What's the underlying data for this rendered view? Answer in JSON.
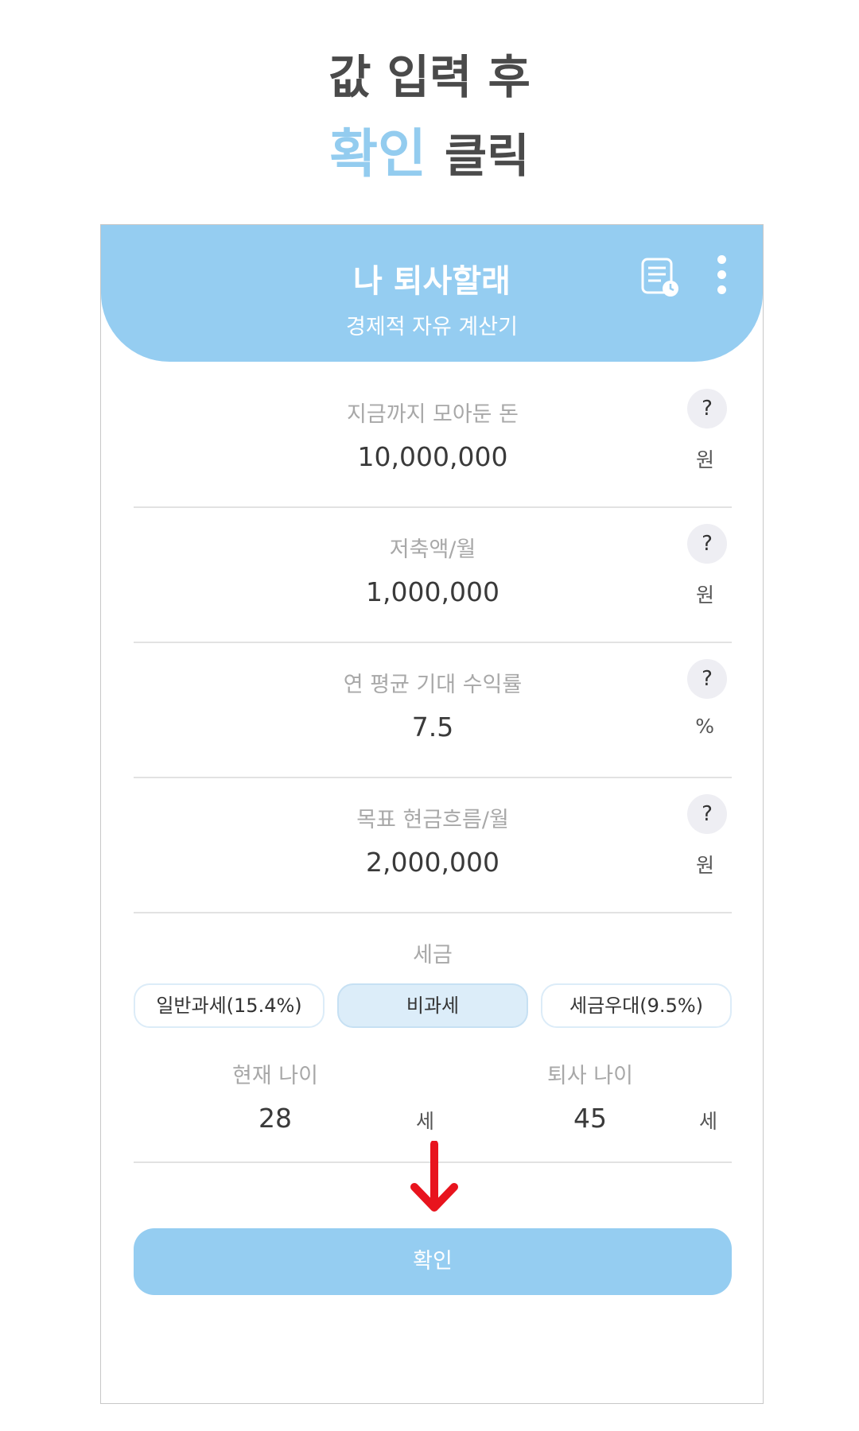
{
  "caption": {
    "line1": "값 입력 후",
    "line2_highlight": "확인",
    "line2_rest": "클릭"
  },
  "app": {
    "title": "나 퇴사할래",
    "subtitle": "경제적 자유 계산기",
    "icons": [
      "history-list-icon",
      "more-vert-icon"
    ]
  },
  "fields": [
    {
      "label": "지금까지 모아둔 돈",
      "value": "10,000,000",
      "unit": "원",
      "help": "?"
    },
    {
      "label": "저축액/월",
      "value": "1,000,000",
      "unit": "원",
      "help": "?"
    },
    {
      "label": "연 평균 기대 수익률",
      "value": "7.5",
      "unit": "%",
      "help": "?"
    },
    {
      "label": "목표 현금흐름/월",
      "value": "2,000,000",
      "unit": "원",
      "help": "?"
    }
  ],
  "tax": {
    "label": "세금",
    "options": [
      "일반과세(15.4%)",
      "비과세",
      "세금우대(9.5%)"
    ],
    "selected": "비과세"
  },
  "ages": {
    "current": {
      "label": "현재 나이",
      "value": "28",
      "unit": "세"
    },
    "retire": {
      "label": "퇴사 나이",
      "value": "45",
      "unit": "세"
    }
  },
  "confirm_label": "확인",
  "colors": {
    "accent": "#95cdf1",
    "selected_bg": "#dcedf9",
    "arrow": "#e8141e"
  }
}
